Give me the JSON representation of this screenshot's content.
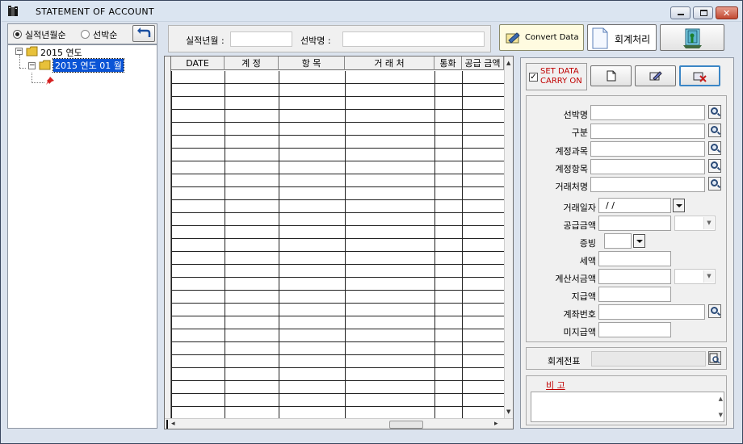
{
  "window": {
    "title": "STATEMENT  OF  ACCOUNT"
  },
  "sort": {
    "option1": "실적년월순",
    "option2": "선박순",
    "selected": "option1"
  },
  "tree": {
    "root": "2015 연도",
    "child": "2015 연도  01 월"
  },
  "filter": {
    "period_label": "실적년월 :",
    "ship_label": "선박명 :",
    "period_value": "",
    "ship_value": ""
  },
  "toolbar": {
    "convert_label": "Convert Data",
    "accounting_label": "회계처리"
  },
  "grid": {
    "columns": [
      "DATE",
      "계 정",
      "항 목",
      "거 래 처",
      "통화",
      "공급 금액"
    ]
  },
  "right": {
    "set_data_line1": "SET DATA",
    "set_data_line2": "CARRY ON",
    "set_data_checked": true,
    "form": {
      "ship_name": "선박명",
      "category": "구분",
      "account_subject": "계정과목",
      "account_item": "계정항목",
      "vendor": "거래처명",
      "trans_date": "거래일자",
      "trans_date_value": " / /",
      "supply_amount": "공급금액",
      "evidence": "증빙",
      "tax": "세액",
      "invoice_amount": "계산서금액",
      "paid_amount": "지급액",
      "account_number": "계좌번호",
      "unpaid_amount": "미지급액"
    },
    "slip_label": "회계전표",
    "memo_label": "비 고"
  },
  "colors": {
    "accent_red": "#c00000",
    "window_bg": "#dbe3ee",
    "frame": "#39465e"
  }
}
